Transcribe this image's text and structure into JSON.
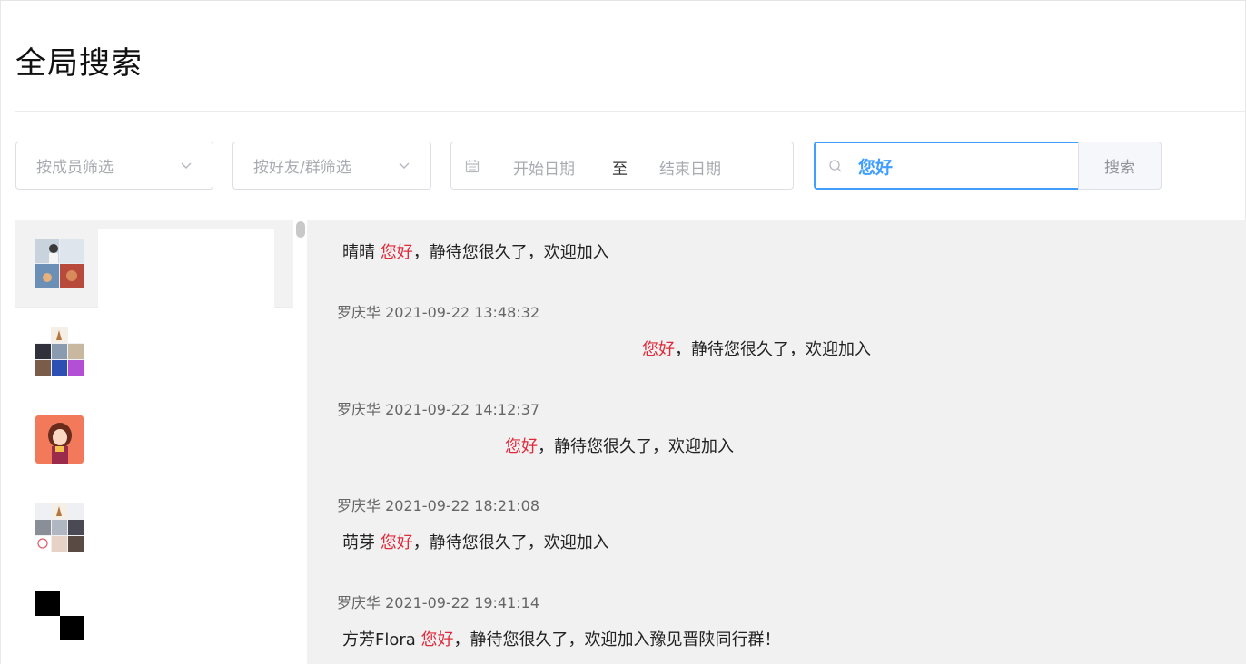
{
  "header": {
    "title": "全局搜索"
  },
  "filters": {
    "member_placeholder": "按成员筛选",
    "friend_group_placeholder": "按好友/群筛选",
    "date_start_placeholder": "开始日期",
    "date_separator": "至",
    "date_end_placeholder": "结束日期",
    "search_value": "您好",
    "search_button": "搜索"
  },
  "colors": {
    "accent": "#409eff",
    "highlight": "#e02a3c"
  },
  "conversations": [
    {
      "avatar": "photo-collage-avatar",
      "selected": true
    },
    {
      "avatar": "photo-collage-avatar",
      "selected": false
    },
    {
      "avatar": "cartoon-girl-avatar",
      "selected": false
    },
    {
      "avatar": "photo-collage-avatar",
      "selected": false
    },
    {
      "avatar": "checker-avatar",
      "selected": false
    }
  ],
  "messages": [
    {
      "meta": "",
      "prefix": "晴晴 ",
      "keyword": "您好",
      "suffix": "，静待您很久了，欢迎加入"
    },
    {
      "meta": "罗庆华 2021-09-22 13:48:32",
      "prefix": "",
      "keyword": "您好",
      "suffix": "，静待您很久了，欢迎加入"
    },
    {
      "meta": "罗庆华 2021-09-22 14:12:37",
      "prefix": "",
      "keyword": "您好",
      "suffix": "，静待您很久了，欢迎加入"
    },
    {
      "meta": "罗庆华 2021-09-22 18:21:08",
      "prefix": "萌芽 ",
      "keyword": "您好",
      "suffix": "，静待您很久了，欢迎加入"
    },
    {
      "meta": "罗庆华 2021-09-22 19:41:14",
      "prefix": "方芳Flora ",
      "keyword": "您好",
      "suffix": "，静待您很久了，欢迎加入豫见晋陕同行群！"
    }
  ]
}
